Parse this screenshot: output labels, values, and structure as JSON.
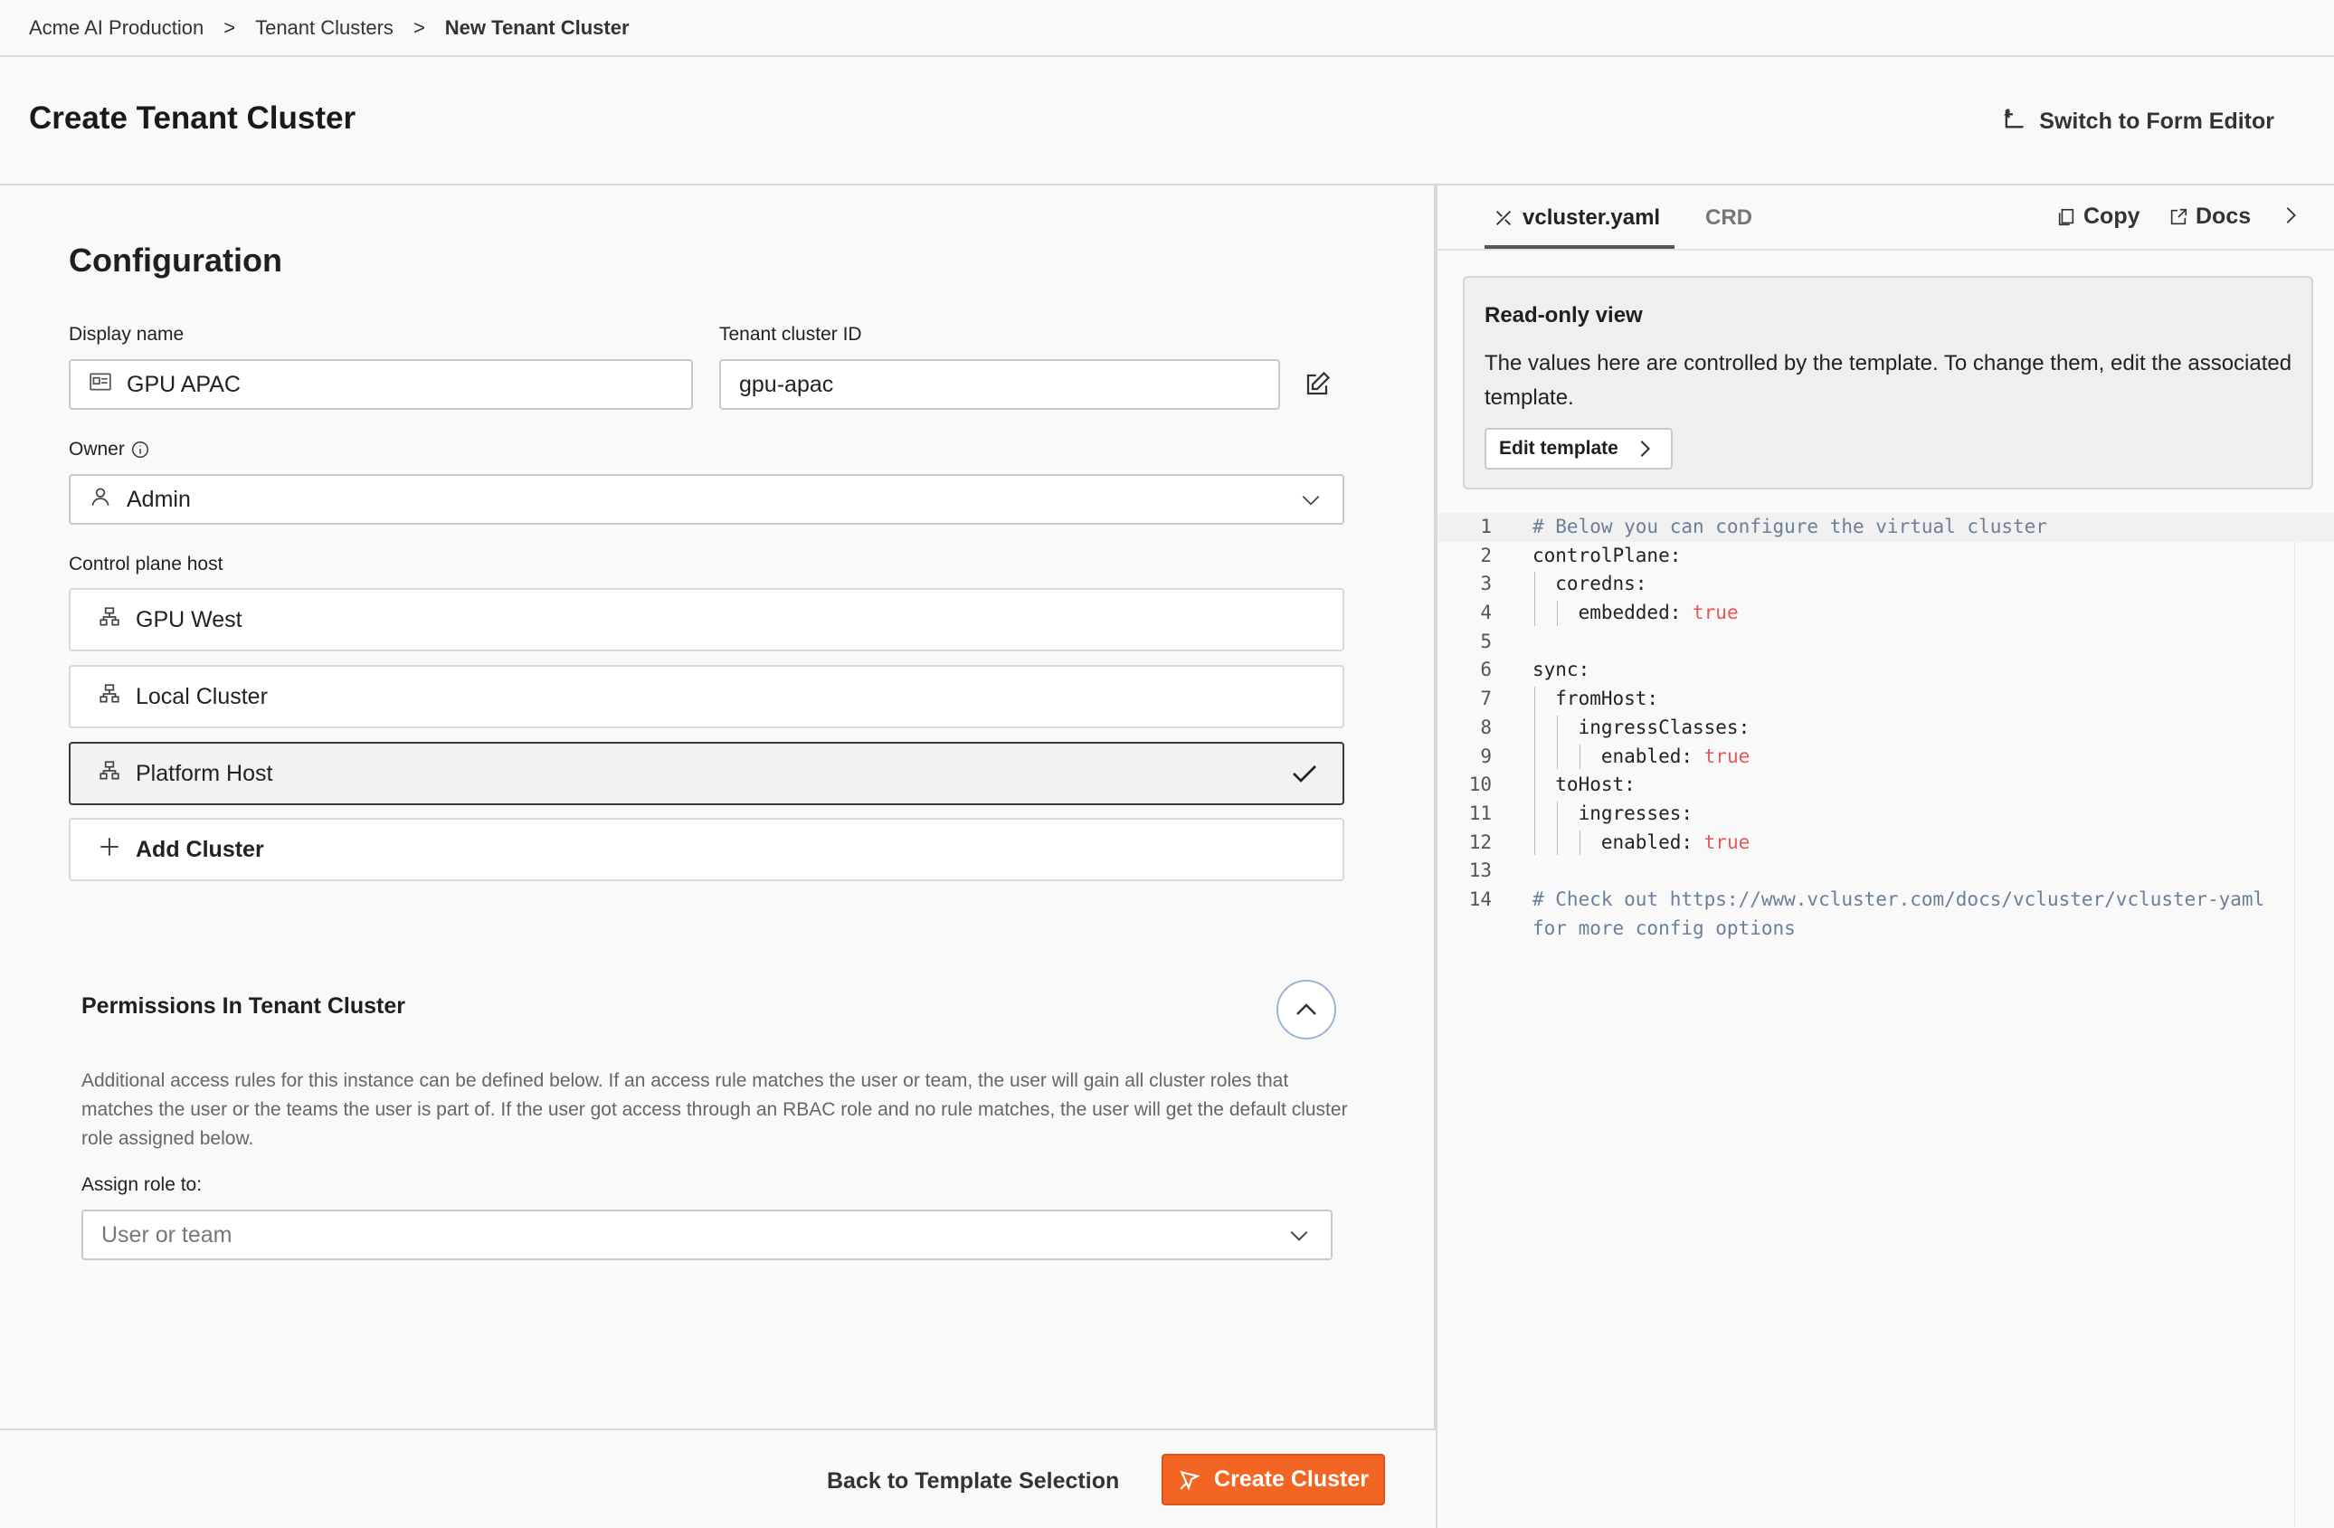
{
  "breadcrumb": {
    "items": [
      "Acme AI Production",
      "Tenant Clusters",
      "New Tenant Cluster"
    ],
    "separator": ">"
  },
  "header": {
    "title": "Create Tenant Cluster",
    "switch_label": "Switch to Form Editor"
  },
  "config": {
    "title": "Configuration",
    "display_name_label": "Display name",
    "display_name_value": "GPU APAC",
    "cluster_id_label": "Tenant cluster ID",
    "cluster_id_value": "gpu-apac",
    "owner_label": "Owner",
    "owner_value": "Admin",
    "host_label": "Control plane host",
    "hosts": [
      {
        "label": "GPU West",
        "selected": false
      },
      {
        "label": "Local Cluster",
        "selected": false
      },
      {
        "label": "Platform Host",
        "selected": true
      }
    ],
    "add_cluster_label": "Add Cluster"
  },
  "permissions": {
    "title": "Permissions In Tenant Cluster",
    "description": "Additional access rules for this instance can be defined below. If an access rule matches the user or team, the user will gain all cluster roles that matches the user or the teams the user is part of. If the user got access through an RBAC role and no rule matches, the user will get the default cluster role assigned below.",
    "assign_label": "Assign role to:",
    "assign_placeholder": "User or team"
  },
  "footer": {
    "back_label": "Back to Template Selection",
    "create_label": "Create Cluster"
  },
  "right_panel": {
    "tabs": [
      "vcluster.yaml",
      "CRD"
    ],
    "copy_label": "Copy",
    "docs_label": "Docs",
    "notice": {
      "title": "Read-only view",
      "text": "The values here are controlled by the template. To change them, edit the associated template.",
      "button": "Edit template"
    },
    "code_lines": [
      "# Below you can configure the virtual cluster",
      "controlPlane:",
      "  coredns:",
      "    embedded: true",
      "",
      "sync:",
      "  fromHost:",
      "    ingressClasses:",
      "      enabled: true",
      "  toHost:",
      "    ingresses:",
      "      enabled: true",
      "",
      "# Check out https://www.vcluster.com/docs/vcluster/vcluster-yaml",
      "for more config options"
    ],
    "line_numbers": [
      "1",
      "2",
      "3",
      "4",
      "5",
      "6",
      "7",
      "8",
      "9",
      "10",
      "11",
      "12",
      "13",
      "14",
      ""
    ]
  },
  "colors": {
    "accent": "#f26522",
    "comment": "#6a7f99",
    "boolean": "#e2585c"
  }
}
